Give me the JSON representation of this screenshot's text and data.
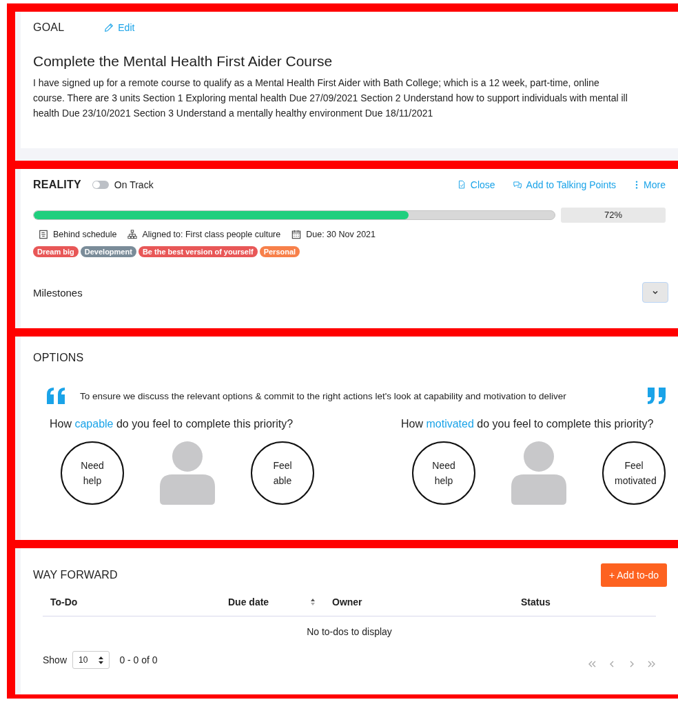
{
  "goal": {
    "heading": "GOAL",
    "edit_link": "Edit",
    "title": "Complete the Mental Health First Aider Course",
    "description": "I have signed up for a remote course to qualify as a Mental Health First Aider with Bath College; which is a 12 week, part-time, online course. There are 3 units Section 1 Exploring mental health Due 27/09/2021 Section 2 Understand how to support individuals with mental ill health Due 23/10/2021 Section 3 Understand a mentally healthy environment Due 18/11/2021"
  },
  "reality": {
    "heading": "REALITY",
    "toggle": {
      "label": "On Track",
      "on": false
    },
    "actions": [
      {
        "kind": "close",
        "label": "Close"
      },
      {
        "kind": "talk",
        "label": "Add to Talking Points"
      },
      {
        "kind": "more",
        "label": "More"
      }
    ],
    "progress": {
      "level": 0.72,
      "reading": "72%"
    },
    "meta": [
      {
        "kind": "schedule",
        "label": "Behind schedule"
      },
      {
        "kind": "aligned",
        "label": "Aligned to: First class people culture"
      },
      {
        "kind": "due",
        "label": "Due: 30 Nov 2021"
      }
    ],
    "tags": [
      {
        "label": "Dream big",
        "color": "#e85757"
      },
      {
        "label": "Development",
        "color": "#7a8c99"
      },
      {
        "label": "Be the best version of yourself",
        "color": "#e85757"
      },
      {
        "label": "Personal",
        "color": "#f7804a"
      }
    ],
    "milestones": {
      "label": "Milestones",
      "expanded": false
    }
  },
  "options": {
    "heading": "OPTIONS",
    "quote": "To ensure we discuss the relevant options & commit to the right actions let's look at capability and motivation to deliver",
    "questions": [
      {
        "prefix": "How",
        "highlight": "capable",
        "suffix": "do you feel to complete this priority?",
        "low": "Need help",
        "high": "Feel able"
      },
      {
        "prefix": "How",
        "highlight": "motivated",
        "suffix": "do you feel to complete this priority?",
        "low": "Need help",
        "high": "Feel motivated"
      }
    ]
  },
  "way_forward": {
    "heading": "WAY FORWARD",
    "add_button": "+ Add to-do",
    "table": {
      "columns": [
        {
          "label": "To-Do",
          "sortable": false
        },
        {
          "label": "Due date",
          "sortable": true
        },
        {
          "label": "Owner",
          "sortable": false
        },
        {
          "label": "Status",
          "sortable": false
        }
      ],
      "empty_message": "No to-dos to display"
    },
    "pager": {
      "show_label": "Show",
      "page_size": "10",
      "range": "0 - 0 of 0"
    }
  }
}
